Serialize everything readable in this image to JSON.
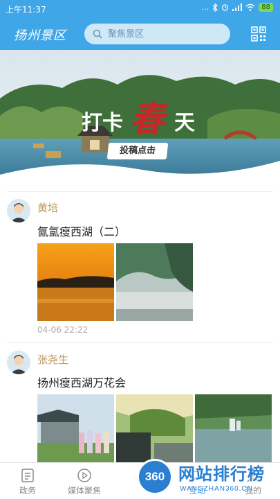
{
  "status_bar": {
    "time": "上午11:37",
    "signal": "...",
    "battery": "88"
  },
  "header": {
    "title": "扬州景区",
    "search_placeholder": "聚焦景区"
  },
  "banner": {
    "headline_part1": "打卡",
    "headline_part2": "春",
    "headline_part3": "天",
    "cta": "投稿点击"
  },
  "posts": [
    {
      "author": "黄培",
      "title": "氤氲瘦西湖（二）",
      "time": "04-06 22:22"
    },
    {
      "author": "张尧生",
      "title": "扬州瘦西湖万花会"
    }
  ],
  "tabs": [
    {
      "label": "政务",
      "icon": "document-icon"
    },
    {
      "label": "媒体聚焦",
      "icon": "play-icon"
    },
    {
      "label": "互动",
      "icon": "interact-icon"
    },
    {
      "label": "我的",
      "icon": "profile-icon"
    }
  ],
  "watermark": {
    "logo": "360",
    "title": "网站排行榜",
    "subtitle": "WANGZHAN360.CN"
  },
  "colors": {
    "primary": "#3fa6e8",
    "author": "#c09a5c",
    "banner_accent": "#c62828"
  }
}
